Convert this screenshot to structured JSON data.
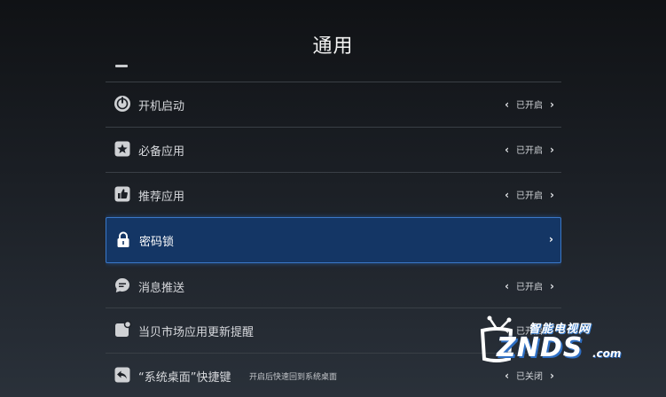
{
  "page": {
    "title": "通用"
  },
  "settings": [
    {
      "label": "开机启动",
      "icon": "power-icon",
      "value": "已开启"
    },
    {
      "label": "必备应用",
      "icon": "star-icon",
      "value": "已开启"
    },
    {
      "label": "推荐应用",
      "icon": "thumbs-up-icon",
      "value": "已开启"
    },
    {
      "label": "密码锁",
      "icon": "lock-icon",
      "value": "",
      "selected": true
    },
    {
      "label": "消息推送",
      "icon": "chat-icon",
      "value": "已开启"
    },
    {
      "label": "当贝市场应用更新提醒",
      "icon": "notification-icon",
      "value": "已开启"
    },
    {
      "label": "“系统桌面”快捷键",
      "icon": "return-icon",
      "description": "开启后快速回到系统桌面",
      "value": "已关闭"
    }
  ],
  "watermark": {
    "top": "智能电视网",
    "main": "ZNDS",
    "suffix": ".com"
  },
  "colors": {
    "selected_bg": "#143665",
    "selected_border": "#3a78c8",
    "divider": "#3a3f46"
  }
}
